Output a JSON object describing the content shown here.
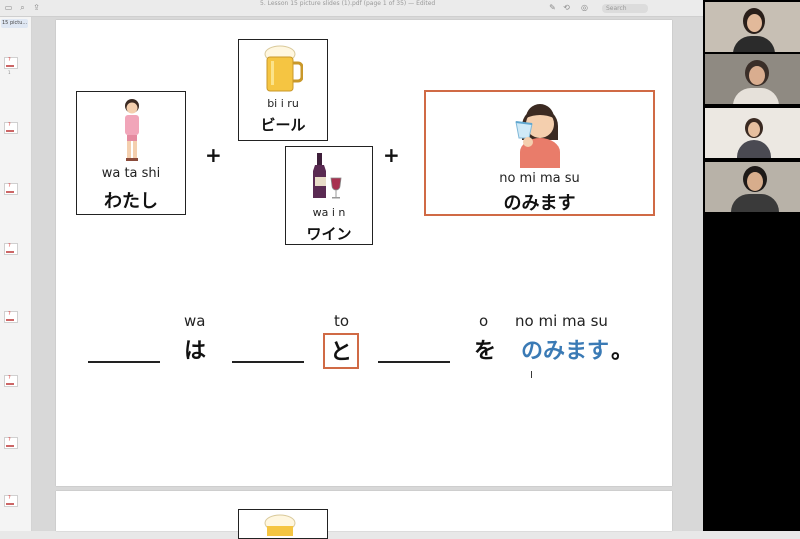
{
  "window": {
    "title": "5. Lesson 15 picture slides (1).pdf (page 1 of 35) — Edited",
    "search_placeholder": "Search"
  },
  "sidebar": {
    "label": "15 pictu...",
    "numbers": [
      "1",
      "",
      "",
      "",
      "",
      "",
      "",
      ""
    ]
  },
  "slide": {
    "subject_card": {
      "romaji": "wa ta shi",
      "kana": "わたし"
    },
    "drink_card_1": {
      "romaji": "bi i ru",
      "kana": "ビール"
    },
    "drink_card_2": {
      "romaji": "wa i n",
      "kana": "ワイン"
    },
    "verb_card": {
      "romaji": "no mi ma su",
      "kana": "のみます"
    },
    "plus_1": "+",
    "plus_2": "+",
    "sentence": {
      "particle_wa": {
        "kana": "は",
        "romaji": "wa"
      },
      "particle_to": {
        "kana": "と",
        "romaji": "to"
      },
      "particle_o": {
        "kana": "を",
        "romaji": "o"
      },
      "verb": {
        "kana": "のみます",
        "romaji": "no mi ma su"
      },
      "period": "。"
    },
    "cursor": "I"
  },
  "colors": {
    "accent_orange": "#d06a45",
    "verb_blue": "#3a7ab5"
  }
}
